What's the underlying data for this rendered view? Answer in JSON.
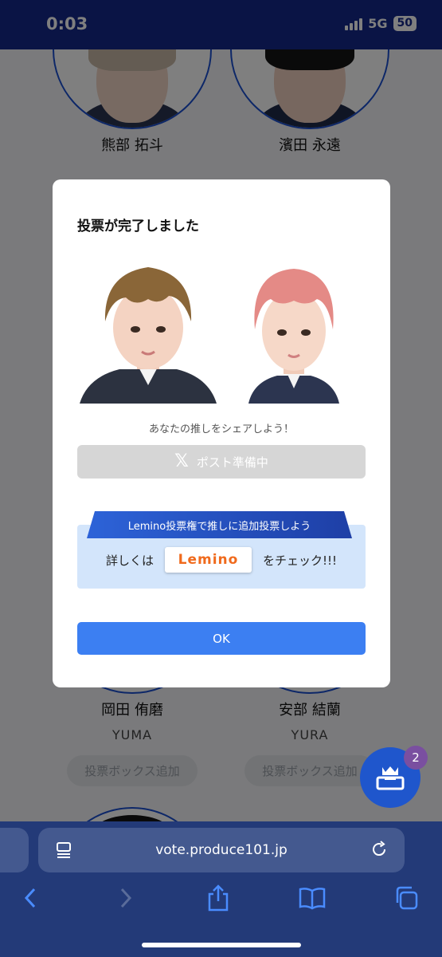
{
  "status_bar": {
    "time": "0:03",
    "network": "5G",
    "battery": "50"
  },
  "candidates": [
    {
      "name": "熊部 拓斗"
    },
    {
      "name": "濱田 永遠"
    },
    {
      "name": "岡田 侑磨",
      "roman": "YUMA",
      "button": "投票ボックス追加"
    },
    {
      "name": "安部 結蘭",
      "roman": "YURA",
      "button": "投票ボックス追加"
    }
  ],
  "fab": {
    "icon": "crown-ballot-box-icon",
    "badge": "2"
  },
  "modal": {
    "title": "投票が完了しました",
    "share_text": "あなたの推しをシェアしよう！",
    "post_button": "ポスト準備中",
    "lemino_banner": "Lemino投票権で推しに追加投票しよう",
    "lemino_prefix": "詳しくは",
    "lemino_logo": "Lemino",
    "lemino_suffix": "をチェック!!!",
    "ok_button": "OK"
  },
  "browser": {
    "url": "vote.produce101.jp"
  },
  "colors": {
    "brand_navy": "#15288a",
    "primary_blue": "#3c7ff2",
    "disabled_gray": "#d6d6d6",
    "lemino_orange": "#f06a1c"
  }
}
